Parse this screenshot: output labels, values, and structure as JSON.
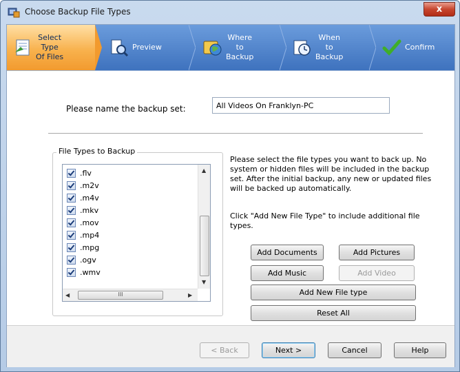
{
  "window": {
    "title": "Choose Backup File Types",
    "close_label": "x"
  },
  "steps": [
    {
      "label": "Select\nType\nOf Files",
      "icon": "document-icon",
      "active": true
    },
    {
      "label": "Preview",
      "icon": "preview-icon",
      "active": false
    },
    {
      "label": "Where\nto\nBackup",
      "icon": "globe-icon",
      "active": false
    },
    {
      "label": "When\nto\nBackup",
      "icon": "clock-icon",
      "active": false
    },
    {
      "label": "Confirm",
      "icon": "checkmark-icon",
      "active": false
    }
  ],
  "backup_set": {
    "label": "Please name the backup set:",
    "value": "All Videos On Franklyn-PC"
  },
  "file_types": {
    "group_title": "File Types to Backup",
    "items": [
      ".flv",
      ".m2v",
      ".m4v",
      ".mkv",
      ".mov",
      ".mp4",
      ".mpg",
      ".ogv",
      ".wmv"
    ],
    "scroll_thumb_label": "III"
  },
  "info": {
    "paragraph1": "Please select the file types you want to back up. No system or hidden files will be included in the backup set. After the initial backup, any new or updated files will be backed up automatically.",
    "paragraph2": "Click \"Add New File Type\" to include additional file types."
  },
  "buttons": {
    "add_documents": "Add Documents",
    "add_pictures": "Add Pictures",
    "add_music": "Add Music",
    "add_video": "Add Video",
    "add_new_file_type": "Add New File type",
    "reset_all": "Reset All"
  },
  "footer": {
    "back": "< Back",
    "next": "Next >",
    "cancel": "Cancel",
    "help": "Help"
  },
  "colors": {
    "step_bar": "#3e72be",
    "step_active": "#f8b24e",
    "frame": "#b5cbe6"
  }
}
